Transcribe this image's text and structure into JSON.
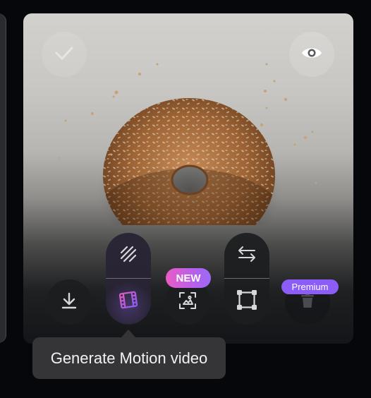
{
  "card": {
    "image_subject": "bagel-with-sesame-seeds"
  },
  "toolbar": {
    "new_badge": "NEW",
    "premium_badge": "Premium"
  },
  "tooltip": {
    "text": "Generate Motion video"
  },
  "colors": {
    "background": "#06070a",
    "tool_bg": "#1c1d20",
    "new_gradient_start": "#e85cc4",
    "new_gradient_end": "#9b6cf2",
    "premium": "#8b5cf6",
    "motion_icon_gradient_start": "#e05ac0",
    "motion_icon_gradient_end": "#8c5cf6"
  },
  "icons": {
    "check": "check-icon",
    "eye": "eye-icon",
    "download": "download-icon",
    "texture": "texture-icon",
    "film": "film-icon",
    "image_scan": "image-scan-icon",
    "swap": "swap-icon",
    "resize": "resize-icon",
    "trash": "trash-icon"
  }
}
